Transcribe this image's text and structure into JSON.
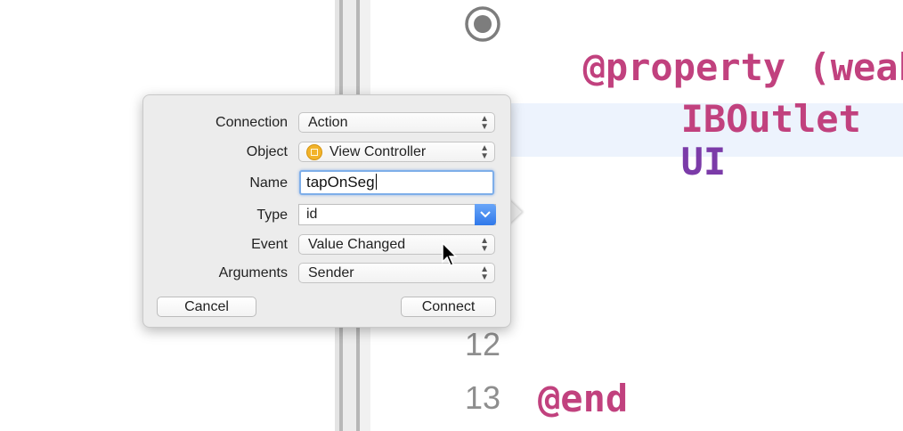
{
  "editor": {
    "code_line1": "@property (weak",
    "code_line2_keyword": "IBOutlet",
    "code_line2_type": "UI",
    "line_12": "12",
    "line_13": "13",
    "code_end": "@end",
    "accent_color": "#c1417e"
  },
  "popover": {
    "connection": {
      "label": "Connection",
      "value": "Action"
    },
    "object": {
      "label": "Object",
      "value": "View Controller",
      "icon": "view-controller-icon"
    },
    "name": {
      "label": "Name",
      "value": "tapOnSeg"
    },
    "type": {
      "label": "Type",
      "value": "id"
    },
    "event": {
      "label": "Event",
      "value": "Value Changed"
    },
    "arguments": {
      "label": "Arguments",
      "value": "Sender"
    },
    "cancel_label": "Cancel",
    "connect_label": "Connect"
  }
}
